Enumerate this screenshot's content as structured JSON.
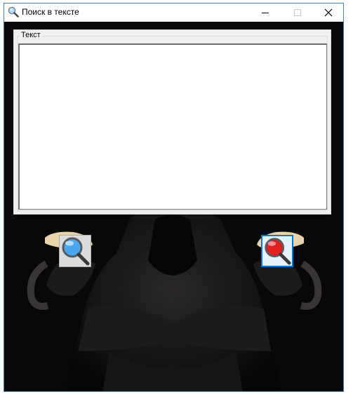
{
  "window": {
    "title": "Поиск в тексте",
    "icon": "magnifier-icon"
  },
  "controls": {
    "minimize": "minimize-icon",
    "maximize": "maximize-icon",
    "close": "close-icon"
  },
  "group": {
    "label": "Текст",
    "text_value": ""
  },
  "buttons": {
    "left": {
      "icon": "search-blue-icon",
      "color": "#3d9be9"
    },
    "right": {
      "icon": "search-red-icon",
      "color": "#e21b1b"
    }
  },
  "colors": {
    "window_border": "#3c7fb1",
    "focus_border": "#0078d7",
    "background": "#0b0b0b"
  }
}
